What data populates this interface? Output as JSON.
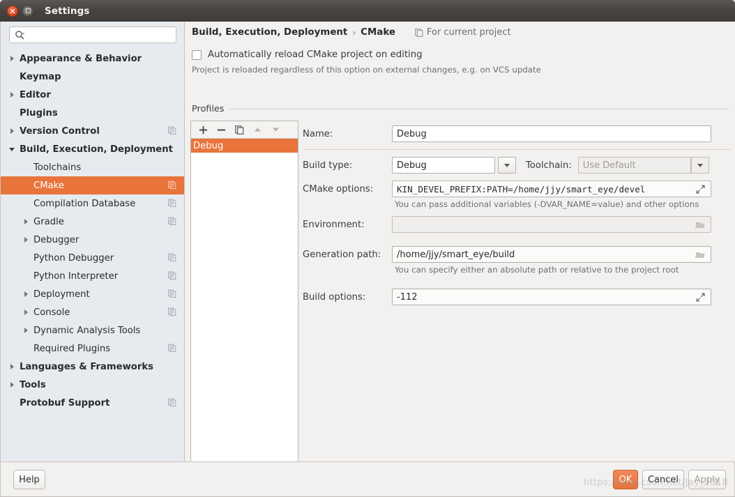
{
  "window": {
    "title": "Settings",
    "close_icon": "close-icon",
    "maximize_icon": "maximize-icon"
  },
  "sidebar": {
    "search": {
      "placeholder": "",
      "value": "",
      "icon": "search-icon"
    },
    "items": [
      {
        "label": "Appearance & Behavior",
        "level": 0,
        "twisty": "right",
        "copy_icon": false,
        "selected": false
      },
      {
        "label": "Keymap",
        "level": 0,
        "twisty": "none",
        "copy_icon": false,
        "selected": false
      },
      {
        "label": "Editor",
        "level": 0,
        "twisty": "right",
        "copy_icon": false,
        "selected": false
      },
      {
        "label": "Plugins",
        "level": 0,
        "twisty": "none",
        "copy_icon": false,
        "selected": false
      },
      {
        "label": "Version Control",
        "level": 0,
        "twisty": "right",
        "copy_icon": true,
        "selected": false
      },
      {
        "label": "Build, Execution, Deployment",
        "level": 0,
        "twisty": "down",
        "copy_icon": false,
        "selected": false
      },
      {
        "label": "Toolchains",
        "level": 1,
        "twisty": "none",
        "copy_icon": false,
        "selected": false
      },
      {
        "label": "CMake",
        "level": 1,
        "twisty": "none",
        "copy_icon": true,
        "selected": true
      },
      {
        "label": "Compilation Database",
        "level": 1,
        "twisty": "none",
        "copy_icon": true,
        "selected": false
      },
      {
        "label": "Gradle",
        "level": 1,
        "twisty": "right",
        "copy_icon": true,
        "selected": false
      },
      {
        "label": "Debugger",
        "level": 1,
        "twisty": "right",
        "copy_icon": false,
        "selected": false
      },
      {
        "label": "Python Debugger",
        "level": 1,
        "twisty": "none",
        "copy_icon": true,
        "selected": false
      },
      {
        "label": "Python Interpreter",
        "level": 1,
        "twisty": "none",
        "copy_icon": true,
        "selected": false
      },
      {
        "label": "Deployment",
        "level": 1,
        "twisty": "right",
        "copy_icon": true,
        "selected": false
      },
      {
        "label": "Console",
        "level": 1,
        "twisty": "right",
        "copy_icon": true,
        "selected": false
      },
      {
        "label": "Dynamic Analysis Tools",
        "level": 1,
        "twisty": "right",
        "copy_icon": false,
        "selected": false
      },
      {
        "label": "Required Plugins",
        "level": 1,
        "twisty": "none",
        "copy_icon": true,
        "selected": false
      },
      {
        "label": "Languages & Frameworks",
        "level": 0,
        "twisty": "right",
        "copy_icon": false,
        "selected": false
      },
      {
        "label": "Tools",
        "level": 0,
        "twisty": "right",
        "copy_icon": false,
        "selected": false
      },
      {
        "label": "Protobuf Support",
        "level": 0,
        "twisty": "none",
        "copy_icon": true,
        "selected": false
      }
    ]
  },
  "main": {
    "breadcrumb": {
      "parent": "Build, Execution, Deployment",
      "separator": "›",
      "current": "CMake",
      "scope_label": "For current project",
      "scope_icon": "project-scope-icon"
    },
    "auto_reload": {
      "label": "Automatically reload CMake project on editing",
      "checked": false,
      "hint": "Project is reloaded regardless of this option on external changes, e.g. on VCS update"
    },
    "profiles_section_label": "Profiles",
    "profiles": {
      "toolbar": [
        {
          "name": "add-profile-button",
          "glyph": "+"
        },
        {
          "name": "remove-profile-button",
          "glyph": "−"
        },
        {
          "name": "copy-profile-button",
          "glyph": "copy"
        },
        {
          "name": "move-up-button",
          "glyph": "up"
        },
        {
          "name": "move-down-button",
          "glyph": "down"
        }
      ],
      "items": [
        {
          "label": "Debug",
          "selected": true
        }
      ]
    },
    "fields": {
      "name": {
        "label": "Name:",
        "value": "Debug"
      },
      "build_type": {
        "label": "Build type:",
        "value": "Debug"
      },
      "toolchain": {
        "label": "Toolchain:",
        "value": "Use Default",
        "is_placeholder": true
      },
      "cmake_options": {
        "label": "CMake options:",
        "value": "KIN_DEVEL_PREFIX:PATH=/home/jjy/smart_eye/devel",
        "hint": "You can pass additional variables (-DVAR_NAME=value) and other options",
        "expand_icon": "expand-icon"
      },
      "environment": {
        "label": "Environment:",
        "value": "",
        "browse_icon": "folder-icon"
      },
      "generation_path": {
        "label": "Generation path:",
        "value": "/home/jjy/smart_eye/build",
        "hint": "You can specify either an absolute path or relative to the project root",
        "browse_icon": "folder-icon"
      },
      "build_options": {
        "label": "Build options:",
        "value": "-112",
        "expand_icon": "expand-icon"
      }
    }
  },
  "footer": {
    "help": "Help",
    "ok": "OK",
    "cancel": "Cancel",
    "apply": "Apply"
  },
  "watermark": "https://blog.csdn.net/Jay_2018",
  "colors": {
    "accent": "#e8743b",
    "sidebar_bg": "#e7ebef",
    "panel_bg": "#f2f1f0",
    "titlebar": "#464340"
  }
}
